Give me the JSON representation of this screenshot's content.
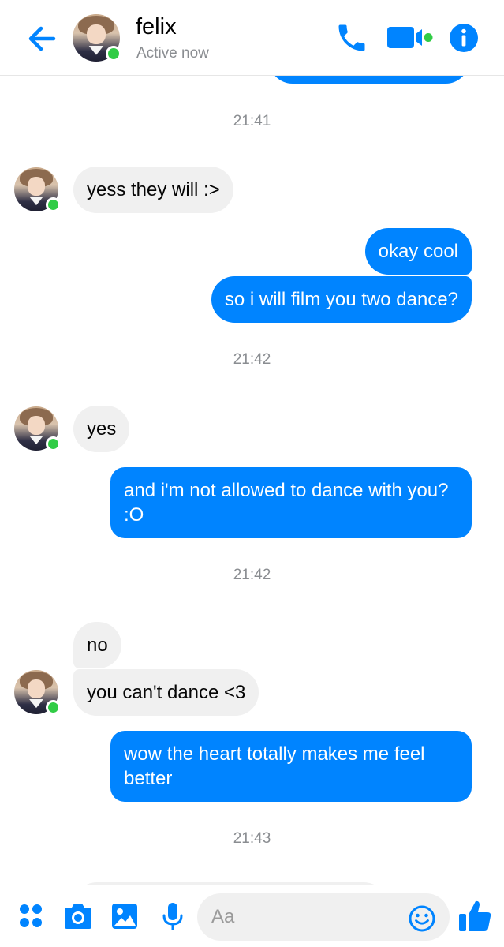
{
  "header": {
    "contact_name": "felix",
    "status": "Active now",
    "icons": {
      "back": "arrow-left-icon",
      "call": "phone-icon",
      "video": "video-camera-icon",
      "info": "info-icon"
    }
  },
  "thread": {
    "timestamps": [
      "21:41",
      "21:42",
      "21:42",
      "21:43"
    ],
    "messages": [
      {
        "from": "felix",
        "text": "yess they will :>"
      },
      {
        "from": "me",
        "text": "okay cool"
      },
      {
        "from": "me",
        "text": "so i will film you two dance?"
      },
      {
        "from": "felix",
        "text": "yes"
      },
      {
        "from": "me",
        "text": "and i'm not allowed to dance with you? :O"
      },
      {
        "from": "felix",
        "text": "no"
      },
      {
        "from": "felix",
        "text": "you can't dance <3"
      },
      {
        "from": "me",
        "text": "wow the heart totally makes me feel better"
      }
    ]
  },
  "composer": {
    "placeholder": "Aa",
    "value": "",
    "icons": [
      "grid-menu-icon",
      "camera-icon",
      "image-icon",
      "microphone-icon",
      "emoji-icon",
      "thumbs-up-icon"
    ]
  },
  "colors": {
    "accent": "#0084ff",
    "presence": "#31cc46",
    "received_bubble": "#f0f0f0",
    "muted_text": "#8a8d91"
  }
}
